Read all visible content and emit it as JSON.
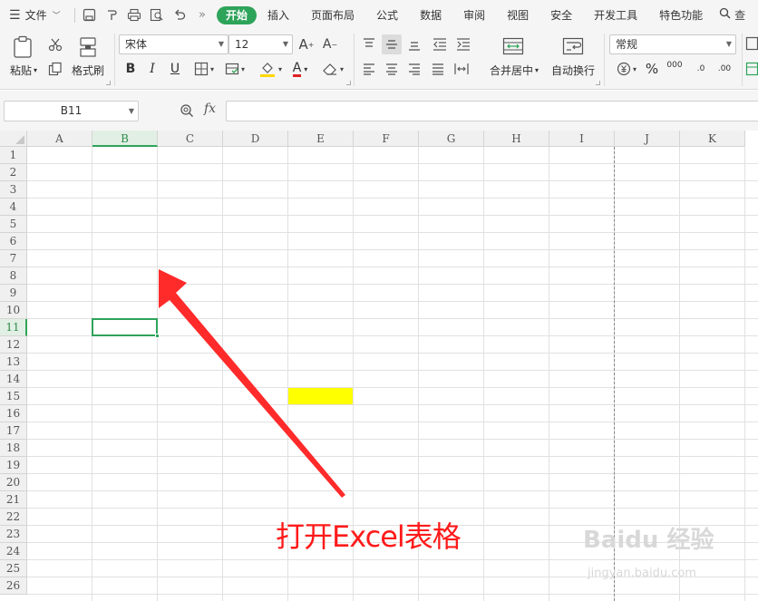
{
  "menu": {
    "hamburger_icon": "menu-icon",
    "file_label": "文件",
    "quick_icons": [
      "save-icon",
      "redo-brush-icon",
      "print-icon",
      "print-preview-icon",
      "undo-icon"
    ],
    "more_label": "»",
    "tabs": [
      "开始",
      "插入",
      "页面布局",
      "公式",
      "数据",
      "审阅",
      "视图",
      "安全",
      "开发工具",
      "特色功能"
    ],
    "active_tab": "开始",
    "search_label": "查"
  },
  "ribbon": {
    "paste_label": "粘贴",
    "format_painter_label": "格式刷",
    "font_name": "宋体",
    "font_size": "12",
    "bold_label": "B",
    "italic_label": "I",
    "underline_label": "U",
    "font_color_letter": "A",
    "merge_label": "合并居中",
    "wrap_label": "自动换行",
    "number_format": "常规",
    "percent_label": "%",
    "thousands_label": "000",
    "dec_inc_label": ".0",
    "dec_dec_label": ".00"
  },
  "formula_bar": {
    "name_box": "B11",
    "fx_label": "fx",
    "formula_value": ""
  },
  "sheet": {
    "columns": [
      "A",
      "B",
      "C",
      "D",
      "E",
      "F",
      "G",
      "H",
      "I",
      "J",
      "K"
    ],
    "rows": [
      "1",
      "2",
      "3",
      "4",
      "5",
      "6",
      "7",
      "8",
      "9",
      "10",
      "11",
      "12",
      "13",
      "14",
      "15",
      "16",
      "17",
      "18",
      "19",
      "20",
      "21",
      "22",
      "23",
      "24",
      "25",
      "26"
    ],
    "selected_column": "B",
    "selected_row": "11",
    "highlight_cell": "E15",
    "highlight_color": "#ffff00",
    "selection_color": "#2ea35a"
  },
  "annotation": {
    "text": "打开Excel表格",
    "color": "#ff1a1a"
  },
  "watermark": {
    "text": "Baidu 经验",
    "sub": "jingyan.baidu.com"
  }
}
